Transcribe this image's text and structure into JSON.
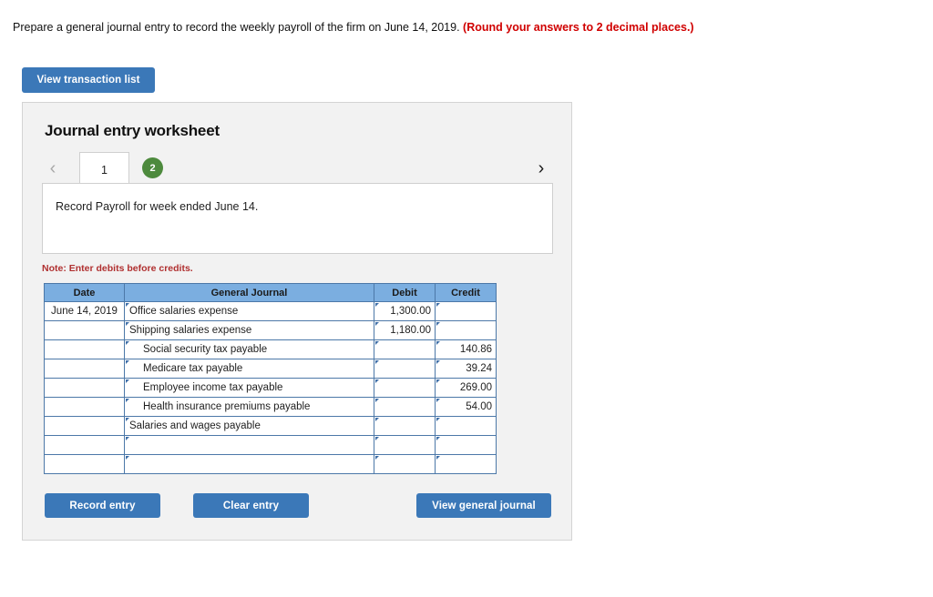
{
  "prompt": {
    "text": "Prepare a general journal entry to record the weekly payroll of the firm on June 14, 2019.",
    "round_note": "(Round your answers to 2 decimal places.)"
  },
  "toolbar": {
    "view_transaction_list_label": "View transaction list"
  },
  "worksheet": {
    "title": "Journal entry worksheet",
    "prev_chevron": "‹",
    "next_chevron": "›",
    "tabs": [
      {
        "label": "1",
        "state": "active"
      },
      {
        "label": "2",
        "state": "badge"
      }
    ],
    "instruction": "Record Payroll for week ended June 14.",
    "note": "Note: Enter debits before credits."
  },
  "table": {
    "headers": [
      "Date",
      "General Journal",
      "Debit",
      "Credit"
    ],
    "rows": [
      {
        "date": "June 14, 2019",
        "account": "Office salaries expense",
        "indent": false,
        "debit": "1,300.00",
        "credit": ""
      },
      {
        "date": "",
        "account": "Shipping salaries expense",
        "indent": false,
        "debit": "1,180.00",
        "credit": ""
      },
      {
        "date": "",
        "account": "Social security tax payable",
        "indent": true,
        "debit": "",
        "credit": "140.86"
      },
      {
        "date": "",
        "account": "Medicare tax payable",
        "indent": true,
        "debit": "",
        "credit": "39.24"
      },
      {
        "date": "",
        "account": "Employee income tax payable",
        "indent": true,
        "debit": "",
        "credit": "269.00"
      },
      {
        "date": "",
        "account": "Health insurance premiums payable",
        "indent": true,
        "debit": "",
        "credit": "54.00"
      },
      {
        "date": "",
        "account": "Salaries and wages payable",
        "indent": false,
        "debit": "",
        "credit": ""
      },
      {
        "date": "",
        "account": "",
        "indent": false,
        "debit": "",
        "credit": ""
      },
      {
        "date": "",
        "account": "",
        "indent": false,
        "debit": "",
        "credit": ""
      }
    ]
  },
  "footer": {
    "record_entry_label": "Record entry",
    "clear_entry_label": "Clear entry",
    "view_general_journal_label": "View general journal"
  },
  "colors": {
    "button_blue": "#3b78b8",
    "table_header_blue": "#7baee0",
    "table_border_blue": "#4c78a8",
    "badge_green": "#4d8a3d",
    "note_red": "#b03030",
    "prompt_red": "#d00000",
    "panel_grey": "#f2f2f2"
  }
}
